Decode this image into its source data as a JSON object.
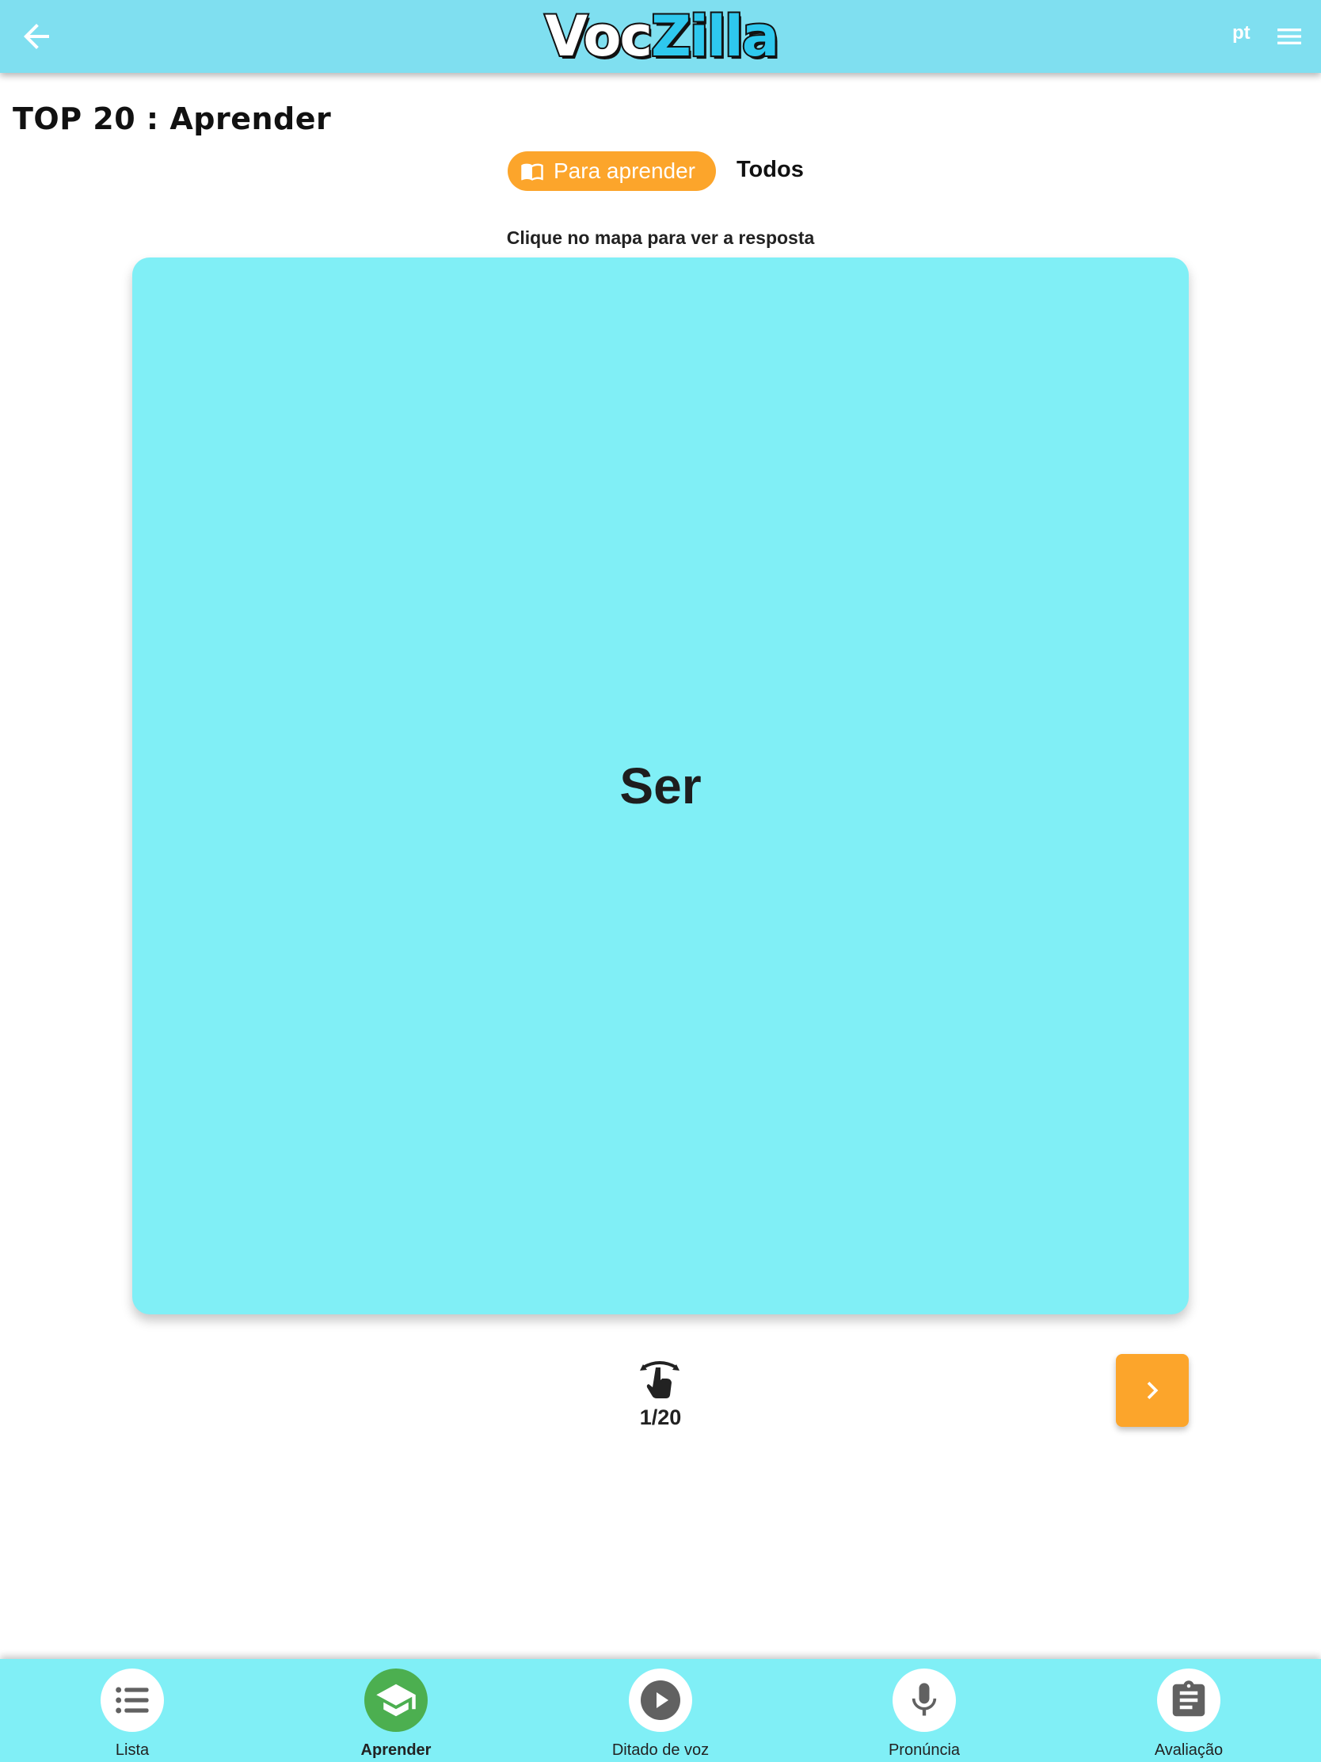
{
  "header": {
    "logo_part1": "Voc",
    "logo_part2": "Zilla",
    "language": "pt",
    "back_icon": "arrow-left-icon",
    "menu_icon": "hamburger-menu-icon"
  },
  "page": {
    "title": "TOP 20 : Aprender"
  },
  "filter": {
    "active_label": "Para aprender",
    "active_icon": "book-open-icon",
    "other_label": "Todos"
  },
  "card": {
    "hint": "Clique no mapa para ver a resposta",
    "word": "Ser",
    "counter": "1/20",
    "flip_icon": "tap-rotate-icon",
    "next_icon": "chevron-right-icon"
  },
  "bottom_nav": [
    {
      "label": "Lista",
      "icon": "list-icon",
      "active": false
    },
    {
      "label": "Aprender",
      "icon": "graduation-cap-icon",
      "active": true
    },
    {
      "label": "Ditado de voz",
      "icon": "play-icon",
      "active": false
    },
    {
      "label": "Pronúncia",
      "icon": "microphone-icon",
      "active": false
    },
    {
      "label": "Avaliação",
      "icon": "clipboard-icon",
      "active": false
    }
  ],
  "colors": {
    "header": "#7fdff0",
    "card": "#80eff6",
    "accent": "#fca52b",
    "active_nav": "#4caf50"
  }
}
